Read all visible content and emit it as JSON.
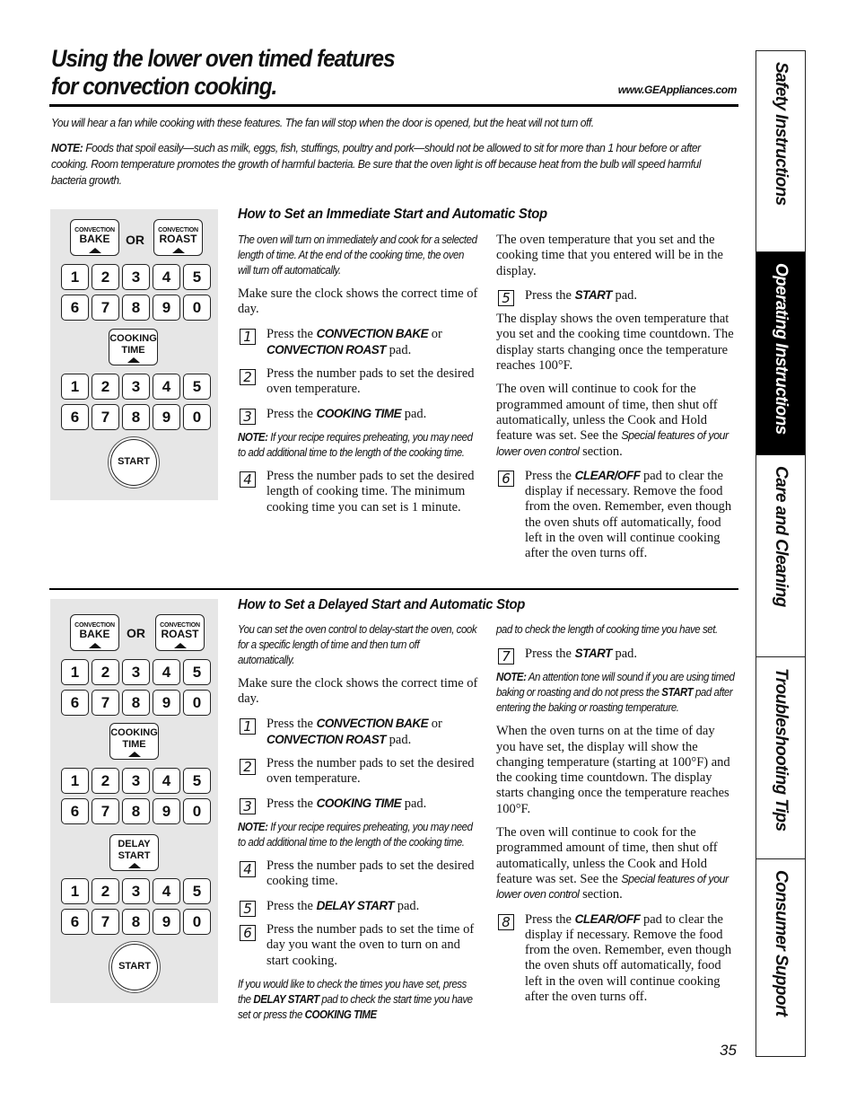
{
  "header": {
    "title_line1": "Using the lower oven timed features",
    "title_line2": "for convection cooking.",
    "website": "www.GEAppliances.com"
  },
  "intro": {
    "fan_note": "You will hear a fan while cooking with these features. The fan will stop when the door is opened, but the heat will not turn off.",
    "note_label": "NOTE:",
    "note_text": " Foods that spoil easily—such as milk, eggs, fish, stuffings, poultry and pork—should not be allowed to sit for more than 1 hour before or after cooking. Room temperature promotes the growth of harmful bacteria. Be sure that the oven light is off because heat from the bulb will speed harmful bacteria growth."
  },
  "keypad": {
    "convection_small": "CONVECTION",
    "bake": "BAKE",
    "roast": "ROAST",
    "or": "OR",
    "cooking": "COOKING",
    "time": "TIME",
    "delay": "DELAY",
    "start_word": "START",
    "start_button": "START",
    "digits_row1": [
      "1",
      "2",
      "3",
      "4",
      "5"
    ],
    "digits_row2": [
      "6",
      "7",
      "8",
      "9",
      "0"
    ]
  },
  "immediate": {
    "heading": "How to Set an Immediate Start and Automatic Stop",
    "intro": "The oven will turn on immediately and cook for a selected length of time. At the end of the cooking time, the oven will turn off automatically.",
    "clock": "Make sure the clock shows the correct time of day.",
    "step1_num": "1",
    "step1_a": "Press the ",
    "step1_kw1": "CONVECTION BAKE",
    "step1_b": " or ",
    "step1_kw2": "CONVECTION ROAST",
    "step1_c": " pad.",
    "step2_num": "2",
    "step2": "Press the number pads to set the desired oven temperature.",
    "step3_num": "3",
    "step3_a": "Press the ",
    "step3_kw": "COOKING TIME",
    "step3_b": " pad.",
    "note_label": "NOTE:",
    "note_text": " If your recipe requires preheating, you may need to add additional time to the length of the cooking time.",
    "step4_num": "4",
    "step4": "Press the number pads to set the desired length of cooking time. The minimum cooking time you can set is 1 minute.",
    "display_note": "The oven temperature that you set and the cooking time that you entered will be in the display.",
    "step5_num": "5",
    "step5_a": "Press the ",
    "step5_kw": "START",
    "step5_b": " pad.",
    "countdown": "The display shows the oven temperature that you set and the cooking time countdown. The display starts changing once the temperature reaches 100°F.",
    "continue_a": "The oven will continue to cook for the programmed amount of time, then shut off automatically, unless the Cook and Hold feature was set. See the ",
    "continue_ref": "Special features of your lower oven control",
    "continue_b": " section.",
    "step6_num": "6",
    "step6_a": "Press the ",
    "step6_kw": "CLEAR/OFF",
    "step6_b": " pad to clear the display if necessary. Remove the food from the oven. Remember, even though the oven shuts off automatically, food left in the oven will continue cooking after the oven turns off."
  },
  "delayed": {
    "heading": "How to Set a Delayed Start and Automatic Stop",
    "intro": "You can set the oven control to delay-start the oven, cook for a specific length of time and then turn off automatically.",
    "clock": "Make sure the clock shows the correct time of day.",
    "step1_num": "1",
    "step1_a": "Press the ",
    "step1_kw1": "CONVECTION BAKE",
    "step1_b": " or ",
    "step1_kw2": "CONVECTION ROAST",
    "step1_c": " pad.",
    "step2_num": "2",
    "step2": "Press the number pads to set the desired oven temperature.",
    "step3_num": "3",
    "step3_a": "Press the ",
    "step3_kw": "COOKING TIME",
    "step3_b": " pad.",
    "note_label": "NOTE:",
    "note_text": " If your recipe requires preheating, you may need to add additional time to the length of the cooking time.",
    "step4_num": "4",
    "step4": "Press the number pads to set the desired cooking time.",
    "step5_num": "5",
    "step5_a": "Press the ",
    "step5_kw": "DELAY START",
    "step5_b": " pad.",
    "step6_num": "6",
    "step6": "Press the number pads to set the time of day you want the oven to turn on and start cooking.",
    "check_a": "If you would like to check the times you have set, press the ",
    "check_kw1": "DELAY START",
    "check_b": " pad to check the start time you have set or press the ",
    "check_kw2": "COOKING TIME",
    "check_c": "pad to check the length of cooking time you have set.",
    "step7_num": "7",
    "step7_a": "Press the ",
    "step7_kw": "START",
    "step7_b": " pad.",
    "note2_label": "NOTE:",
    "note2_a": " An attention tone will sound if you are using timed baking or roasting and do not press the ",
    "note2_kw": "START",
    "note2_b": " pad after entering the baking or roasting temperature.",
    "turns_on": "When the oven turns on at the time of day you have set, the display will show the changing temperature (starting at 100°F) and the cooking time countdown. The display starts changing once the temperature reaches 100°F.",
    "continue_a": "The oven will continue to cook for the programmed amount of time, then shut off automatically, unless the Cook and Hold feature was set. See the ",
    "continue_ref": "Special features of your lower oven control",
    "continue_b": " section.",
    "step8_num": "8",
    "step8_a": "Press the ",
    "step8_kw": "CLEAR/OFF",
    "step8_b": " pad to clear the display if necessary. Remove the food from the oven. Remember, even though the oven shuts off automatically, food left in the oven will continue cooking after the oven turns off."
  },
  "page_number": "35",
  "side_tabs": [
    {
      "label": "Safety Instructions",
      "active": false
    },
    {
      "label": "Operating Instructions",
      "active": true
    },
    {
      "label": "Care and Cleaning",
      "active": false
    },
    {
      "label": "Troubleshooting Tips",
      "active": false
    },
    {
      "label": "Consumer Support",
      "active": false
    }
  ]
}
